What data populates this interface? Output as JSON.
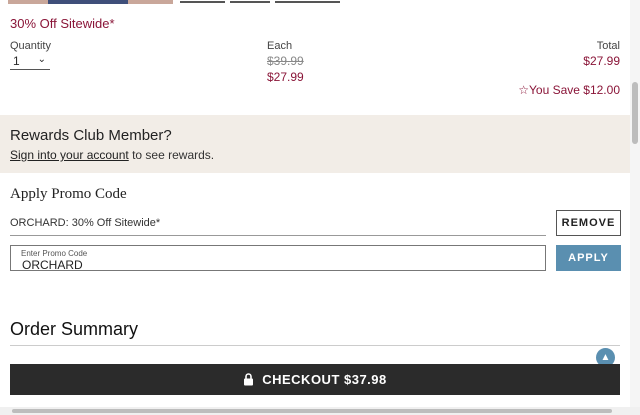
{
  "promo_banner": "30% Off Sitewide*",
  "item": {
    "quantity_label": "Quantity",
    "quantity_value": "1",
    "each_label": "Each",
    "each_original": "$39.99",
    "each_sale": "$27.99",
    "total_label": "Total",
    "total_value": "$27.99",
    "you_save": "You Save $12.00"
  },
  "rewards": {
    "title": "Rewards Club Member?",
    "link_text": "Sign into your account",
    "suffix": " to see rewards."
  },
  "promo": {
    "heading": "Apply Promo Code",
    "applied_code": "ORCHARD: 30% Off Sitewide*",
    "remove_label": "REMOVE",
    "input_placeholder": "Enter Promo Code",
    "input_value": "ORCHARD",
    "apply_label": "APPLY"
  },
  "order_summary": {
    "title": "Order Summary"
  },
  "checkout": {
    "label": "CHECKOUT $37.98"
  },
  "colors": {
    "accent": "#8a1538",
    "button_blue": "#5a8fb0",
    "checkout_bg": "#2b2b2b",
    "rewards_bg": "#f2ede7"
  }
}
